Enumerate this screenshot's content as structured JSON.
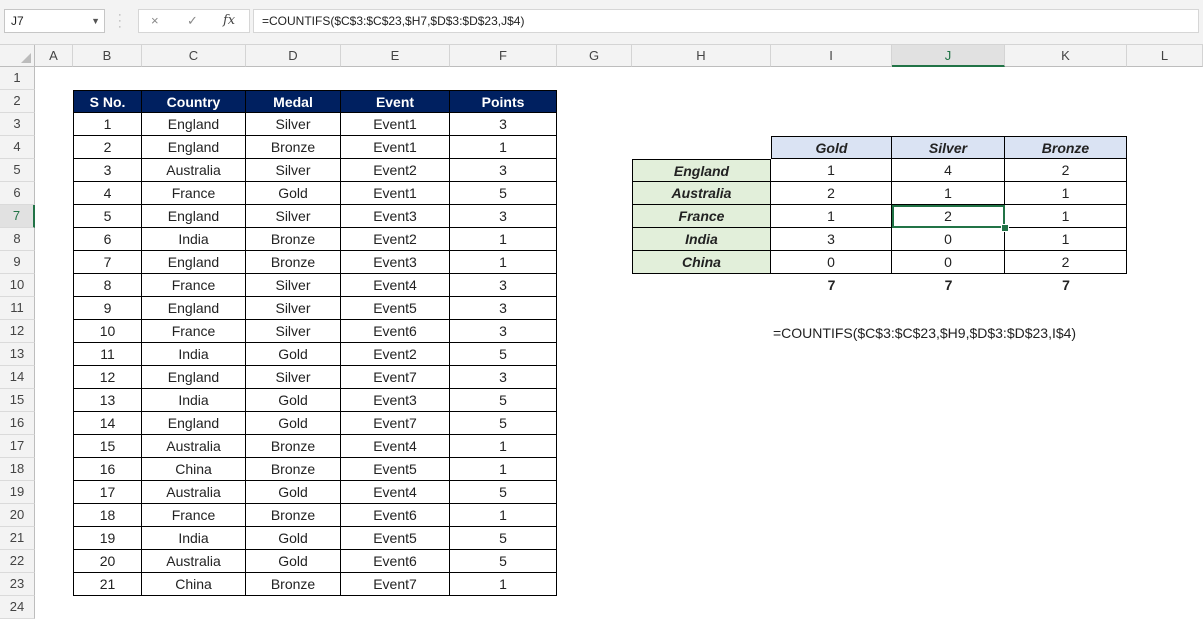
{
  "formula_bar": {
    "name_box": "J7",
    "fx_icon": "fx",
    "cancel_icon": "×",
    "enter_icon": "✓",
    "formula": "=COUNTIFS($C$3:$C$23,$H7,$D$3:$D$23,J$4)"
  },
  "columns": [
    "A",
    "B",
    "C",
    "D",
    "E",
    "F",
    "G",
    "H",
    "I",
    "J",
    "K",
    "L"
  ],
  "rows": [
    "1",
    "2",
    "3",
    "4",
    "5",
    "6",
    "7",
    "8",
    "9",
    "10",
    "11",
    "12",
    "13",
    "14",
    "15",
    "16",
    "17",
    "18",
    "19",
    "20",
    "21",
    "22",
    "23",
    "24"
  ],
  "data_table": {
    "headers": [
      "S No.",
      "Country",
      "Medal",
      "Event",
      "Points"
    ],
    "rows": [
      [
        "1",
        "England",
        "Silver",
        "Event1",
        "3"
      ],
      [
        "2",
        "England",
        "Bronze",
        "Event1",
        "1"
      ],
      [
        "3",
        "Australia",
        "Silver",
        "Event2",
        "3"
      ],
      [
        "4",
        "France",
        "Gold",
        "Event1",
        "5"
      ],
      [
        "5",
        "England",
        "Silver",
        "Event3",
        "3"
      ],
      [
        "6",
        "India",
        "Bronze",
        "Event2",
        "1"
      ],
      [
        "7",
        "England",
        "Bronze",
        "Event3",
        "1"
      ],
      [
        "8",
        "France",
        "Silver",
        "Event4",
        "3"
      ],
      [
        "9",
        "England",
        "Silver",
        "Event5",
        "3"
      ],
      [
        "10",
        "France",
        "Silver",
        "Event6",
        "3"
      ],
      [
        "11",
        "India",
        "Gold",
        "Event2",
        "5"
      ],
      [
        "12",
        "England",
        "Silver",
        "Event7",
        "3"
      ],
      [
        "13",
        "India",
        "Gold",
        "Event3",
        "5"
      ],
      [
        "14",
        "England",
        "Gold",
        "Event7",
        "5"
      ],
      [
        "15",
        "Australia",
        "Bronze",
        "Event4",
        "1"
      ],
      [
        "16",
        "China",
        "Bronze",
        "Event5",
        "1"
      ],
      [
        "17",
        "Australia",
        "Gold",
        "Event4",
        "5"
      ],
      [
        "18",
        "France",
        "Bronze",
        "Event6",
        "1"
      ],
      [
        "19",
        "India",
        "Gold",
        "Event5",
        "5"
      ],
      [
        "20",
        "Australia",
        "Gold",
        "Event6",
        "5"
      ],
      [
        "21",
        "China",
        "Bronze",
        "Event7",
        "1"
      ]
    ]
  },
  "medal_table": {
    "headers": [
      "Gold",
      "Silver",
      "Bronze"
    ],
    "rows": [
      {
        "country": "England",
        "values": [
          "1",
          "4",
          "2"
        ]
      },
      {
        "country": "Australia",
        "values": [
          "2",
          "1",
          "1"
        ]
      },
      {
        "country": "France",
        "values": [
          "1",
          "2",
          "1"
        ]
      },
      {
        "country": "India",
        "values": [
          "3",
          "0",
          "1"
        ]
      },
      {
        "country": "China",
        "values": [
          "0",
          "0",
          "2"
        ]
      }
    ],
    "totals": [
      "7",
      "7",
      "7"
    ]
  },
  "note_formula": "=COUNTIFS($C$3:$C$23,$H9,$D$3:$D$23,I$4)",
  "colors": {
    "header_fill": "#002060",
    "medal_header_fill": "#dae3f3",
    "country_fill": "#e2efda",
    "selection": "#217346"
  }
}
